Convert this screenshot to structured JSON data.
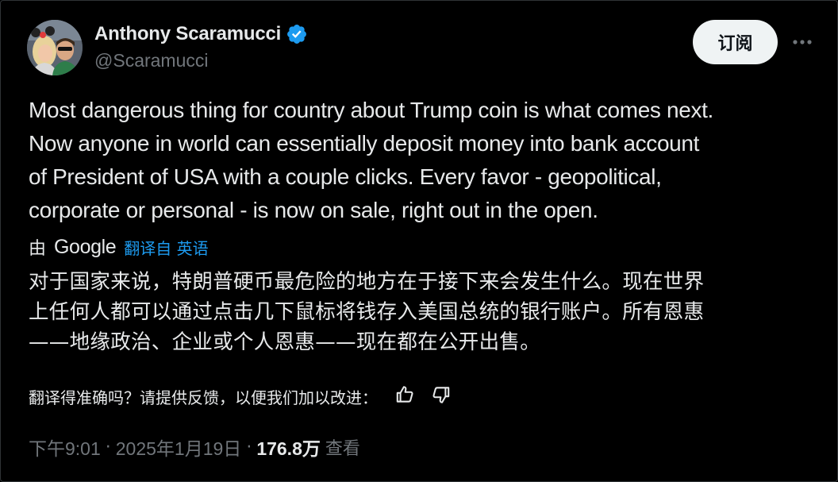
{
  "author": {
    "display_name": "Anthony Scaramucci",
    "handle": "@Scaramucci",
    "verified": true,
    "verified_icon": "verified-badge-icon",
    "verified_color": "#1d9bf0"
  },
  "header": {
    "subscribe_label": "订阅",
    "more_icon": "more-horizontal-icon"
  },
  "tweet": {
    "text": "Most dangerous thing for country about Trump coin is what comes next.\nNow anyone in world can essentially deposit money into bank account\nof President of USA with a couple clicks. Every favor - geopolitical,\ncorporate or personal - is now on sale, right out in the open."
  },
  "translation": {
    "by_label": "由",
    "provider": "Google",
    "translated_from": "翻译自 英语",
    "text": "对于国家来说，特朗普硬币最危险的地方在于接下来会发生什么。现在世界\n上任何人都可以通过点击几下鼠标将钱存入美国总统的银行账户。所有恩惠\n——地缘政治、企业或个人恩惠——现在都在公开出售。",
    "feedback_prompt": "翻译得准确吗？请提供反馈，以便我们加以改进：",
    "thumbs_up_icon": "thumbs-up-icon",
    "thumbs_down_icon": "thumbs-down-icon"
  },
  "meta": {
    "time": "下午9:01",
    "separator": "·",
    "date": "2025年1月19日",
    "views_count": "176.8万",
    "views_label": "查看"
  },
  "colors": {
    "background": "#000000",
    "text_primary": "#e7e9ea",
    "text_secondary": "#71767b",
    "accent": "#1d9bf0",
    "button_bg": "#eff3f4"
  }
}
